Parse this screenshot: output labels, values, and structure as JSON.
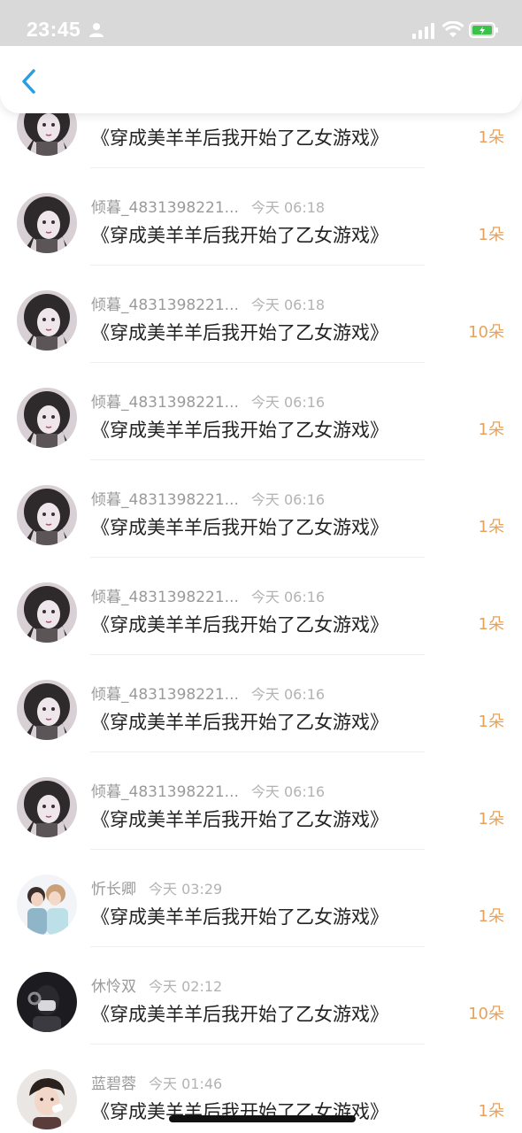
{
  "status_bar": {
    "time": "23:45",
    "icons": [
      "person-icon",
      "signal-icon",
      "wifi-icon",
      "battery-icon"
    ],
    "battery_color": "#3ac24a"
  },
  "header": {
    "back_icon": "chevron-left-icon",
    "accent_color": "#2b9de0"
  },
  "colors": {
    "username": "#9a9a9a",
    "time": "#b3b3b3",
    "title": "#222222",
    "count": "#e6a25a"
  },
  "rows": [
    {
      "user": "",
      "time": "",
      "title": "《穿成美羊羊后我开始了乙女游戏》",
      "count": "1朵",
      "avatar": "dark-haired-girl"
    },
    {
      "user": "倾暮_4831398221...",
      "time": "今天 06:18",
      "title": "《穿成美羊羊后我开始了乙女游戏》",
      "count": "1朵",
      "avatar": "dark-haired-girl"
    },
    {
      "user": "倾暮_4831398221...",
      "time": "今天 06:18",
      "title": "《穿成美羊羊后我开始了乙女游戏》",
      "count": "10朵",
      "avatar": "dark-haired-girl"
    },
    {
      "user": "倾暮_4831398221...",
      "time": "今天 06:16",
      "title": "《穿成美羊羊后我开始了乙女游戏》",
      "count": "1朵",
      "avatar": "dark-haired-girl"
    },
    {
      "user": "倾暮_4831398221...",
      "time": "今天 06:16",
      "title": "《穿成美羊羊后我开始了乙女游戏》",
      "count": "1朵",
      "avatar": "dark-haired-girl"
    },
    {
      "user": "倾暮_4831398221...",
      "time": "今天 06:16",
      "title": "《穿成美羊羊后我开始了乙女游戏》",
      "count": "1朵",
      "avatar": "dark-haired-girl"
    },
    {
      "user": "倾暮_4831398221...",
      "time": "今天 06:16",
      "title": "《穿成美羊羊后我开始了乙女游戏》",
      "count": "1朵",
      "avatar": "dark-haired-girl"
    },
    {
      "user": "倾暮_4831398221...",
      "time": "今天 06:16",
      "title": "《穿成美羊羊后我开始了乙女游戏》",
      "count": "1朵",
      "avatar": "dark-haired-girl"
    },
    {
      "user": "忻长卿",
      "time": "今天 03:29",
      "title": "《穿成美羊羊后我开始了乙女游戏》",
      "count": "1朵",
      "avatar": "couple-photo"
    },
    {
      "user": "休怜双",
      "time": "今天 02:12",
      "title": "《穿成美羊羊后我开始了乙女游戏》",
      "count": "10朵",
      "avatar": "masked-person"
    },
    {
      "user": "蓝碧蓉",
      "time": "今天 01:46",
      "title": "《穿成美羊羊后我开始了乙女游戏》",
      "count": "1朵",
      "avatar": "boy-portrait"
    }
  ]
}
